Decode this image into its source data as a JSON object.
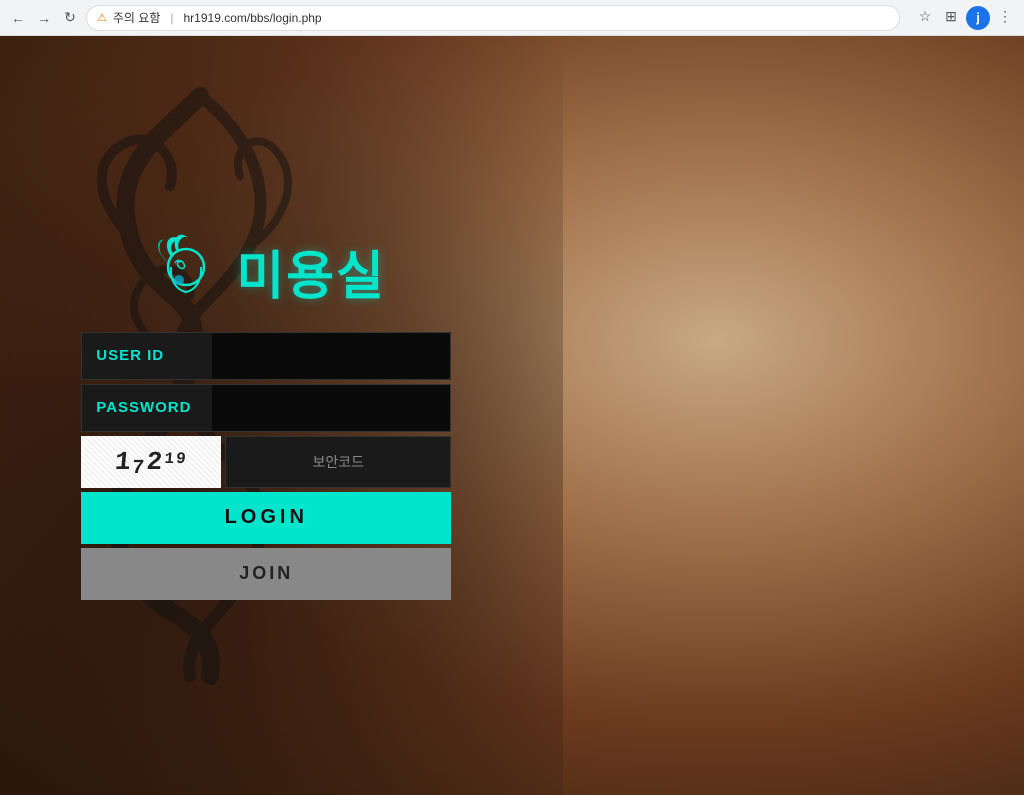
{
  "browser": {
    "url": "hr1919.com/bbs/login.php",
    "warning_text": "주의 요함",
    "back_label": "←",
    "forward_label": "→",
    "reload_label": "↻",
    "user_avatar_label": "j",
    "star_label": "☆",
    "menu_label": "⋮",
    "tab_label": "⊞"
  },
  "logo": {
    "site_name": "미용실"
  },
  "form": {
    "userid_label": "USER ID",
    "userid_placeholder": "",
    "password_label": "PASSWORD",
    "password_placeholder": "",
    "captcha_value": "1₇₂¹⁹",
    "captcha_display": "172 19",
    "captcha_placeholder": "보안코드",
    "login_label": "LOGIN",
    "join_label": "JOIN"
  },
  "colors": {
    "accent": "#00e5cc",
    "bg_dark": "#1a1a1a",
    "join_bg": "#888888"
  }
}
